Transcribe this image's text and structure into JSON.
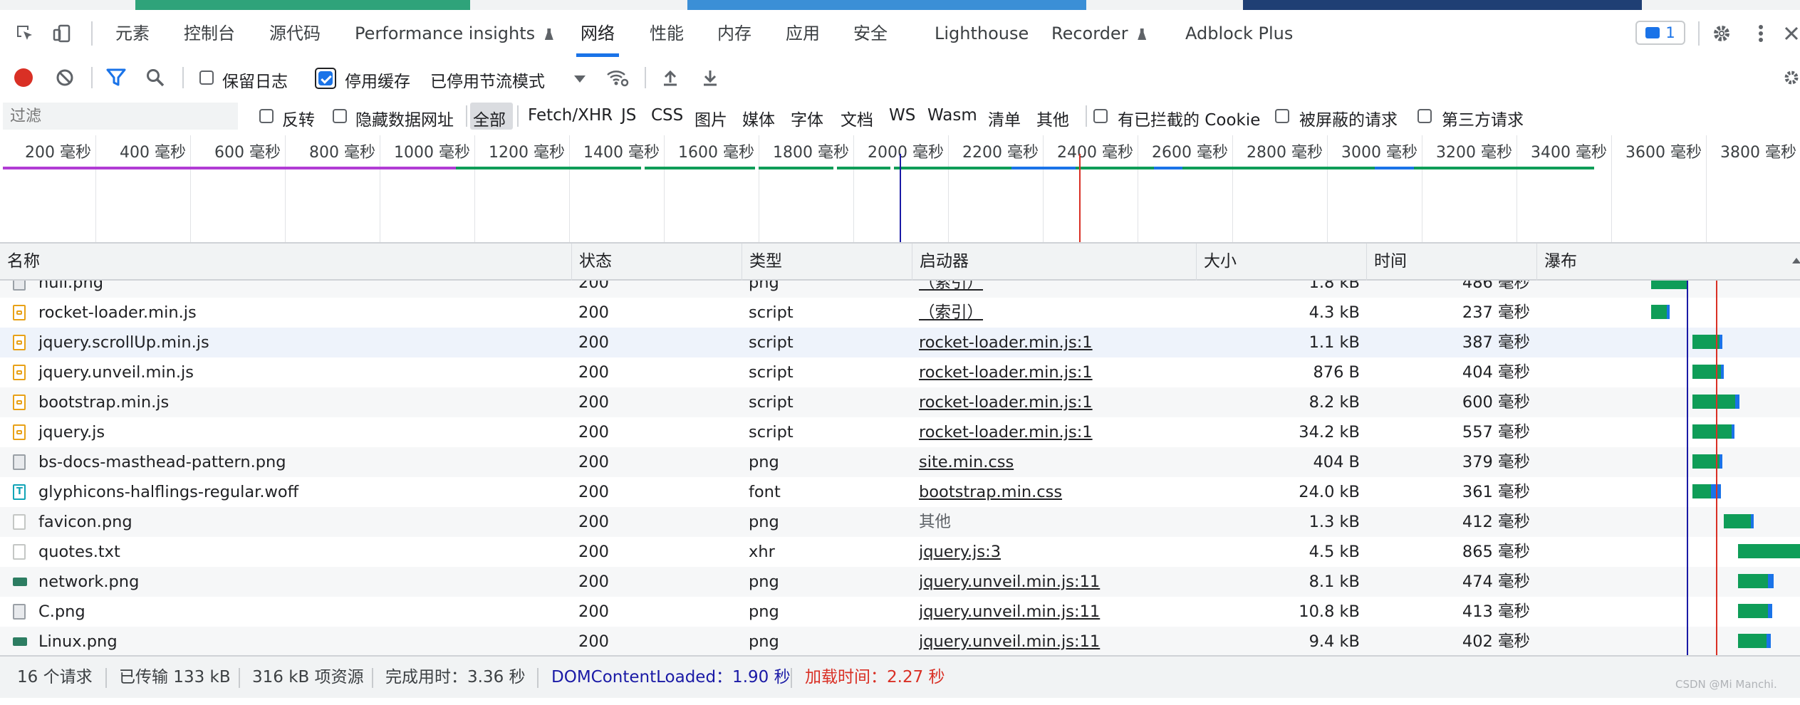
{
  "tabs": [
    {
      "label": "元素"
    },
    {
      "label": "控制台"
    },
    {
      "label": "源代码"
    },
    {
      "label": "Performance insights"
    },
    {
      "label": "网络"
    },
    {
      "label": "性能"
    },
    {
      "label": "内存"
    },
    {
      "label": "应用"
    },
    {
      "label": "安全"
    },
    {
      "label": "Lighthouse"
    },
    {
      "label": "Recorder"
    },
    {
      "label": "Adblock Plus"
    }
  ],
  "issues_badge": "1",
  "network_toolbar": {
    "preserve_log_label": "保留日志",
    "disable_cache_label": "停用缓存",
    "throttling_value": "已停用节流模式"
  },
  "filter_bar": {
    "placeholder": "过滤",
    "invert_label": "反转",
    "hide_data_urls_label": "隐藏数据网址",
    "types": [
      "全部",
      "Fetch/XHR",
      "JS",
      "CSS",
      "图片",
      "媒体",
      "字体",
      "文档",
      "WS",
      "Wasm",
      "清单",
      "其他"
    ],
    "blocked_cookies_label": "有已拦截的 Cookie",
    "blocked_requests_label": "被屏蔽的请求",
    "third_party_label": "第三方请求"
  },
  "timeline": {
    "ticks": [
      "200 毫秒",
      "400 毫秒",
      "600 毫秒",
      "800 毫秒",
      "1000 毫秒",
      "1200 毫秒",
      "1400 毫秒",
      "1600 毫秒",
      "1800 毫秒",
      "2000 毫秒",
      "2200 毫秒",
      "2400 毫秒",
      "2600 毫秒",
      "2800 毫秒",
      "3000 毫秒",
      "3200 毫秒",
      "3400 毫秒",
      "3600 毫秒",
      "3800 毫秒"
    ]
  },
  "columns": {
    "name": "名称",
    "status": "状态",
    "type": "类型",
    "initiator": "启动器",
    "size": "大小",
    "time": "时间",
    "waterfall": "瀑布"
  },
  "rows": [
    {
      "name": "null.png",
      "status": "200",
      "type": "png",
      "initiator": "（索引）",
      "size": "1.8 kB",
      "time": "486 毫秒",
      "icon": "image-icon"
    },
    {
      "name": "rocket-loader.min.js",
      "status": "200",
      "type": "script",
      "initiator": "（索引）",
      "size": "4.3 kB",
      "time": "237 毫秒",
      "icon": "script-icon"
    },
    {
      "name": "jquery.scrollUp.min.js",
      "status": "200",
      "type": "script",
      "initiator": "rocket-loader.min.js:1",
      "size": "1.1 kB",
      "time": "387 毫秒",
      "icon": "script-icon"
    },
    {
      "name": "jquery.unveil.min.js",
      "status": "200",
      "type": "script",
      "initiator": "rocket-loader.min.js:1",
      "size": "876 B",
      "time": "404 毫秒",
      "icon": "script-icon"
    },
    {
      "name": "bootstrap.min.js",
      "status": "200",
      "type": "script",
      "initiator": "rocket-loader.min.js:1",
      "size": "8.2 kB",
      "time": "600 毫秒",
      "icon": "script-icon"
    },
    {
      "name": "jquery.js",
      "status": "200",
      "type": "script",
      "initiator": "rocket-loader.min.js:1",
      "size": "34.2 kB",
      "time": "557 毫秒",
      "icon": "script-icon"
    },
    {
      "name": "bs-docs-masthead-pattern.png",
      "status": "200",
      "type": "png",
      "initiator": "site.min.css",
      "size": "404 B",
      "time": "379 毫秒",
      "icon": "image-icon"
    },
    {
      "name": "glyphicons-halflings-regular.woff",
      "status": "200",
      "type": "font",
      "initiator": "bootstrap.min.css",
      "size": "24.0 kB",
      "time": "361 毫秒",
      "icon": "font-icon"
    },
    {
      "name": "favicon.png",
      "status": "200",
      "type": "png",
      "initiator": "其他",
      "size": "1.3 kB",
      "time": "412 毫秒",
      "icon": "document-icon"
    },
    {
      "name": "quotes.txt",
      "status": "200",
      "type": "xhr",
      "initiator": "jquery.js:3",
      "size": "4.5 kB",
      "time": "865 毫秒",
      "icon": "document-icon"
    },
    {
      "name": "network.png",
      "status": "200",
      "type": "png",
      "initiator": "jquery.unveil.min.js:11",
      "size": "8.1 kB",
      "time": "474 毫秒",
      "icon": "image-thumb-icon"
    },
    {
      "name": "C.png",
      "status": "200",
      "type": "png",
      "initiator": "jquery.unveil.min.js:11",
      "size": "10.8 kB",
      "time": "413 毫秒",
      "icon": "image-icon"
    },
    {
      "name": "Linux.png",
      "status": "200",
      "type": "png",
      "initiator": "jquery.unveil.min.js:11",
      "size": "9.4 kB",
      "time": "402 毫秒",
      "icon": "image-thumb-icon"
    }
  ],
  "status_bar": {
    "requests": "16 个请求",
    "transferred": "已传输 133 kB",
    "resources": "316 kB 项资源",
    "finish": "完成用时：3.36 秒",
    "dom_content_loaded": "DOMContentLoaded：1.90 秒",
    "load": "加载时间：2.27 秒"
  },
  "watermark": "CSDN @Mi    Manchi.",
  "colors": {
    "accent": "#1a73e8",
    "record": "#d93025",
    "bar_green": "#0f9d58",
    "bar_blue": "#1a73e8",
    "dcl_line": "#1a1aa6",
    "load_line": "#d93025"
  }
}
